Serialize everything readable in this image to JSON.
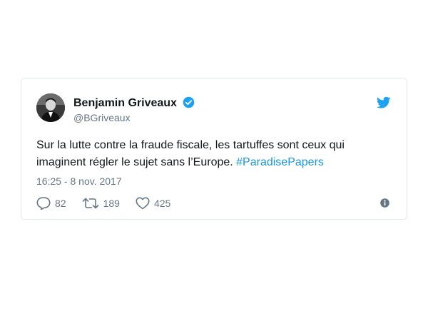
{
  "tweet": {
    "author_name": "Benjamin Griveaux",
    "author_handle": "@BGriveaux",
    "text_main": "Sur la lutte contre la fraude fiscale, les tartuffes sont ceux qui imaginent régler le sujet sans l’Europe. ",
    "hashtag": "#ParadisePapers",
    "timestamp": "16:25 - 8 nov. 2017",
    "replies": "82",
    "retweets": "189",
    "likes": "425"
  },
  "icons": {
    "avatar": "avatar",
    "verified": "verified-badge-icon",
    "brand": "twitter-bird-icon",
    "reply": "reply-icon",
    "retweet": "retweet-icon",
    "like": "heart-icon",
    "info": "info-icon"
  },
  "colors": {
    "accent": "#1da1f2",
    "hashtag": "#1b95e0",
    "text": "#14171a",
    "muted": "#657786",
    "border": "#e1e8ed"
  }
}
